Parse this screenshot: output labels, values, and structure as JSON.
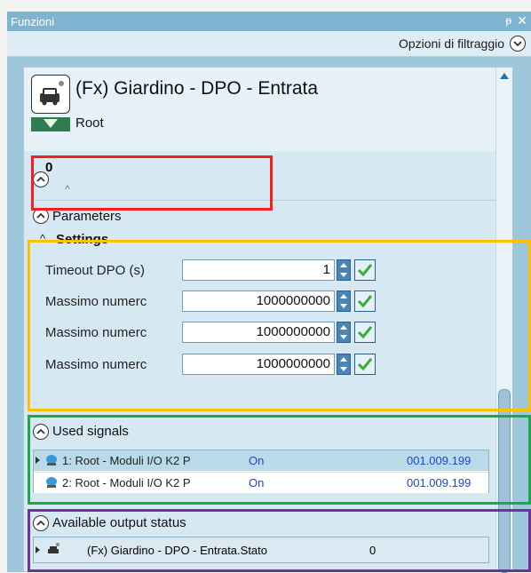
{
  "window": {
    "title": "Funzioni",
    "pin": "ᵽ",
    "close": "✕"
  },
  "filter": {
    "label": "Opzioni di filtraggio"
  },
  "function": {
    "title": "(Fx) Giardino - DPO - Entrata",
    "root": "Root"
  },
  "group_value": "0",
  "parameters_label": "Parameters",
  "settings": {
    "label": "Settings",
    "rows": [
      {
        "label": "Timeout DPO (s)",
        "value": "1"
      },
      {
        "label": "Massimo numerc",
        "value": "1000000000"
      },
      {
        "label": "Massimo numerc",
        "value": "1000000000"
      },
      {
        "label": "Massimo numerc",
        "value": "1000000000"
      }
    ]
  },
  "used_signals": {
    "label": "Used signals",
    "rows": [
      {
        "name": "1: Root - Moduli I/O K2 P",
        "state": "On",
        "address": "001.009.199"
      },
      {
        "name": "2: Root - Moduli I/O K2 P",
        "state": "On",
        "address": "001.009.199"
      }
    ]
  },
  "output_status": {
    "label": "Available output status",
    "row": {
      "name": "(Fx) Giardino - DPO - Entrata.Stato",
      "value": "0"
    }
  },
  "highlight_colors": {
    "red": "#ff1b1b",
    "orange": "#ffc000",
    "green": "#1aa84b",
    "purple": "#7030a0"
  }
}
